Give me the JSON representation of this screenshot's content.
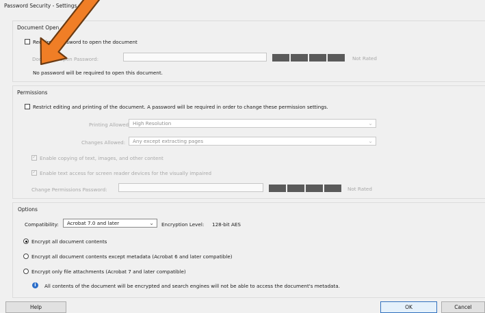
{
  "window": {
    "title": "Password Security - Settings"
  },
  "document_open": {
    "section_label": "Document Open",
    "require_password_label": "Require a password to open the document",
    "require_password_checked": false,
    "password_label": "Document Open Password:",
    "password_value": "",
    "strength_text": "Not Rated",
    "note": "No password will be required to open this document."
  },
  "permissions": {
    "section_label": "Permissions",
    "restrict_label": "Restrict editing and printing of the document. A password will be required in order to change these permission settings.",
    "restrict_checked": false,
    "printing_label": "Printing Allowed:",
    "printing_value": "High Resolution",
    "changes_label": "Changes Allowed:",
    "changes_value": "Any except extracting pages",
    "enable_copying_label": "Enable copying of text, images, and other content",
    "enable_copying_checked": true,
    "enable_screen_reader_label": "Enable text access for screen reader devices for the visually impaired",
    "enable_screen_reader_checked": true,
    "change_password_label": "Change Permissions Password:",
    "change_password_value": "",
    "strength_text": "Not Rated"
  },
  "options": {
    "section_label": "Options",
    "compatibility_label": "Compatibility:",
    "compatibility_value": "Acrobat 7.0 and later",
    "encryption_label": "Encryption  Level:",
    "encryption_value": "128-bit AES",
    "radio_all": "Encrypt all document contents",
    "radio_except_metadata": "Encrypt all document contents except metadata (Acrobat 6 and later compatible)",
    "radio_attachments": "Encrypt only file attachments (Acrobat 7 and later compatible)",
    "selected": "all",
    "info_text": "All contents of the document will be encrypted and search engines will not be able to access the document's metadata."
  },
  "buttons": {
    "help": "Help",
    "ok": "OK",
    "cancel": "Cancel"
  },
  "colors": {
    "annotation_arrow": "#f07e26",
    "meter_block": "#5a5a5a",
    "info_icon": "#2a6dc9",
    "ok_border": "#2f6fbd"
  },
  "icons": [
    "checkbox",
    "radio-button",
    "chevron-down-icon",
    "info-icon",
    "orange-arrow-annotation"
  ]
}
